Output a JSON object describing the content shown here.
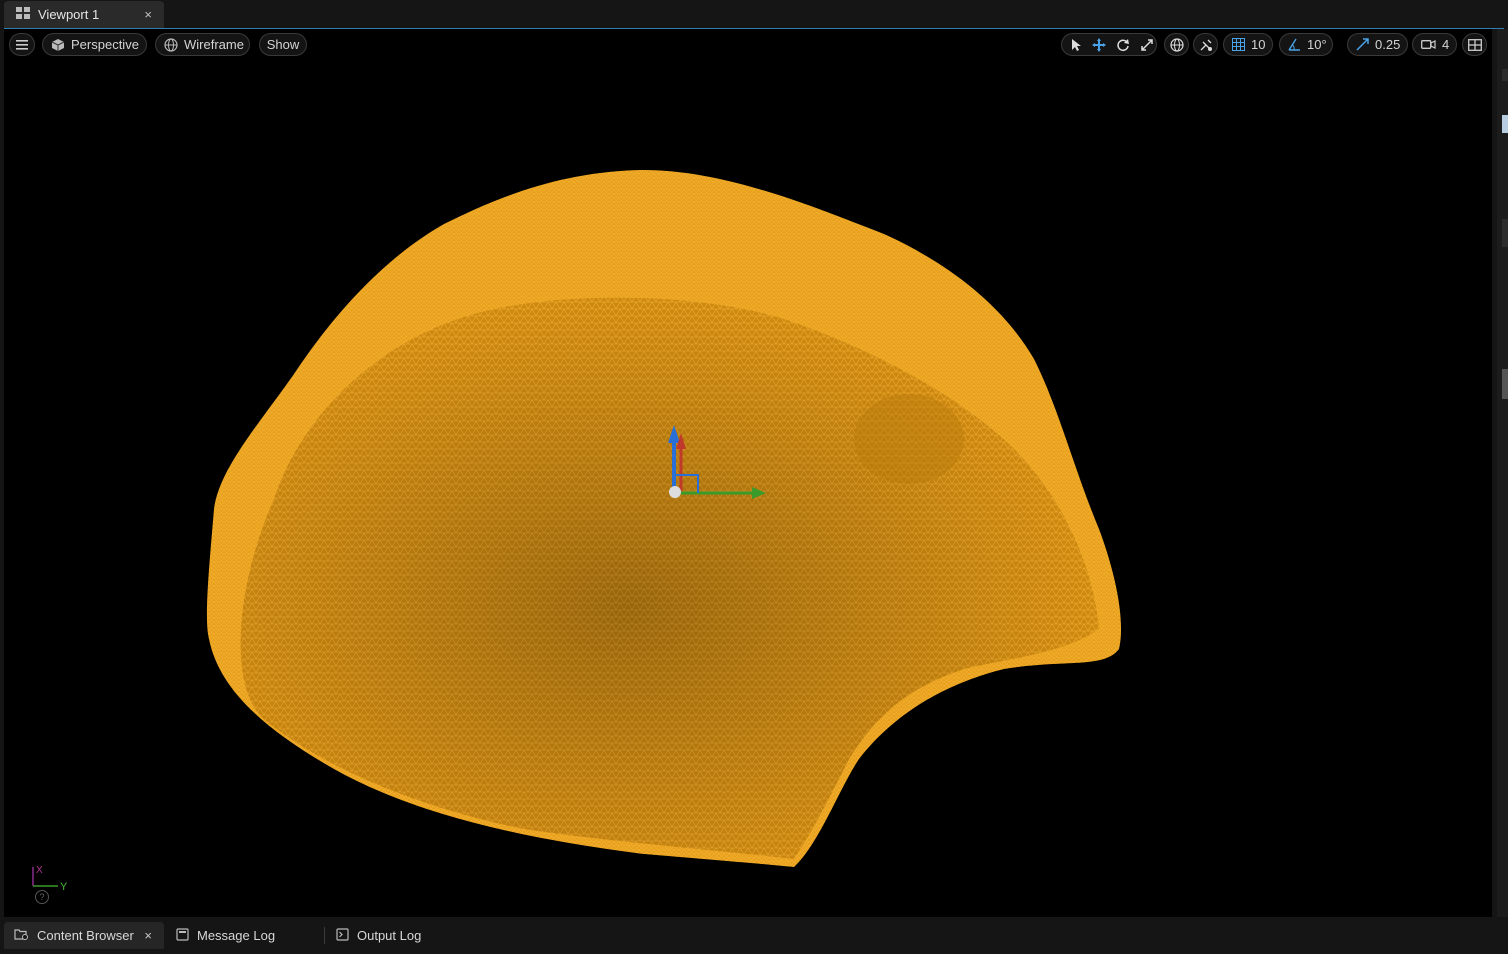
{
  "tab": {
    "title": "Viewport 1",
    "close": "×"
  },
  "toolbar": {
    "view_mode": "Perspective",
    "render_mode": "Wireframe",
    "show_label": "Show",
    "grid_snap": "10",
    "rotation_snap": "10°",
    "scale_snap": "0.25",
    "camera_speed": "4"
  },
  "axis": {
    "x": "X",
    "y": "Y",
    "help": "?"
  },
  "bottom_tabs": [
    {
      "label": "Content Browser",
      "close": "×"
    },
    {
      "label": "Message Log"
    },
    {
      "label": "Output Log"
    }
  ],
  "colors": {
    "mesh": "#e8a01a",
    "accent": "#2f7fb0",
    "gizmo_z": "#2a6fd6",
    "gizmo_x": "#c0392b",
    "gizmo_y": "#3a9a2a"
  }
}
